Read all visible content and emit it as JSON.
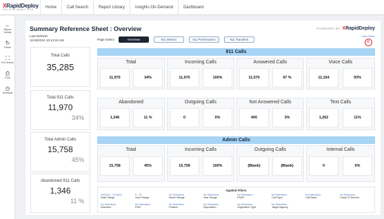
{
  "topbar": {
    "brand_main": "RapidDeploy",
    "brand_x": "X",
    "brand_sub": "ECLIPSE ANALYTICS",
    "nav": [
      "Home",
      "Call Search",
      "Report Library",
      "Insights On-Demand",
      "Dashboard"
    ]
  },
  "sidebar": {
    "items": [
      {
        "icon": "back-arrow-icon",
        "glyph": "←",
        "label": "Report Library"
      },
      {
        "icon": "reset-icon",
        "glyph": "↻",
        "label": "Reset"
      },
      {
        "icon": "fullscreen-icon",
        "glyph": "⛶",
        "label": "Full Screen"
      },
      {
        "icon": "print-icon",
        "glyph": "⎙",
        "label": "Print"
      },
      {
        "icon": "clock-icon",
        "glyph": "◷",
        "label": "Schedule"
      }
    ]
  },
  "header": {
    "title": "Summary Reference Sheet : Overview",
    "powered_by": "POWERED BY",
    "last_refresh_label": "Last Refresh",
    "last_refresh_value": "11/19/2024 10:13:24 AM",
    "page_select_label": "Page Select",
    "tabs": [
      "Overview",
      "911 Metrics",
      "911 Performance",
      "911 Transfers"
    ],
    "clear_filters": "Clear Filters"
  },
  "left_cards": [
    {
      "title": "Total Calls",
      "value": "35,285",
      "percent": ""
    },
    {
      "title": "Total 911 Calls",
      "value": "11,970",
      "percent": "34%"
    },
    {
      "title": "Total Admin Calls",
      "value": "15,758",
      "percent": "45%"
    },
    {
      "title": "Abandoned 911 Calls",
      "value": "1,346",
      "percent": "11 %"
    }
  ],
  "section_911": {
    "title": "911 Calls",
    "row1": [
      {
        "label": "Total",
        "values": [
          "11,970",
          "34%"
        ]
      },
      {
        "label": "Incoming Calls",
        "values": [
          "11,970",
          "100%"
        ]
      },
      {
        "label": "Answered Calls",
        "values": [
          "11,570",
          "97 %"
        ]
      },
      {
        "label": "Voice Calls",
        "values": [
          "11,154",
          "93%"
        ]
      }
    ],
    "row2": [
      {
        "label": "Abandoned",
        "values": [
          "1,346",
          "11 %"
        ]
      },
      {
        "label": "Outgoing Calls",
        "values": [
          "0",
          "0%"
        ]
      },
      {
        "label": "Not Answered Calls",
        "values": [
          "400",
          "3%"
        ]
      },
      {
        "label": "Text Calls",
        "values": [
          "1,262",
          "11%"
        ]
      }
    ]
  },
  "section_admin": {
    "title": "Admin Calls",
    "row1": [
      {
        "label": "Total",
        "values": [
          "15,758",
          "45%"
        ]
      },
      {
        "label": "Incoming Calls",
        "values": [
          "15,758",
          "100%"
        ]
      },
      {
        "label": "Outgoing Calls",
        "values": [
          "(Blank)",
          "(Blank)"
        ]
      },
      {
        "label": "Internal Calls",
        "values": [
          "0",
          "0%"
        ]
      }
    ]
  },
  "applied_filters": {
    "title": "Applied Filters",
    "row1": [
      {
        "value": "10/20/24 - 11/18/24",
        "label": "Date Range"
      },
      {
        "value": "0 - 23",
        "label": "Hour Range"
      },
      {
        "value": "No Selections",
        "label": "Month Range"
      },
      {
        "value": "No Selections",
        "label": "Year Range"
      },
      {
        "value": "No Selections",
        "label": "PSAP"
      },
      {
        "value": "No Selections",
        "label": "Call Type"
      },
      {
        "value": "No Selections",
        "label": "Call Taker"
      },
      {
        "value": "No Selections",
        "label": "Class Of Service"
      }
    ],
    "row2": [
      {
        "value": "No Selections",
        "label": "Direction"
      },
      {
        "value": "No Selections",
        "label": "ESN"
      },
      {
        "value": "No Selections",
        "label": "Position"
      },
      {
        "value": "No Selections",
        "label": "Disposition"
      },
      {
        "value": "No Selections",
        "label": "Origination Type"
      },
      {
        "value": "No Selections",
        "label": "Target Agency"
      }
    ]
  },
  "colors": {
    "accent_blue": "#a8d4f5",
    "brand_red": "#d8262f",
    "link_blue": "#4a78b8",
    "active_tab": "#1d2433"
  }
}
